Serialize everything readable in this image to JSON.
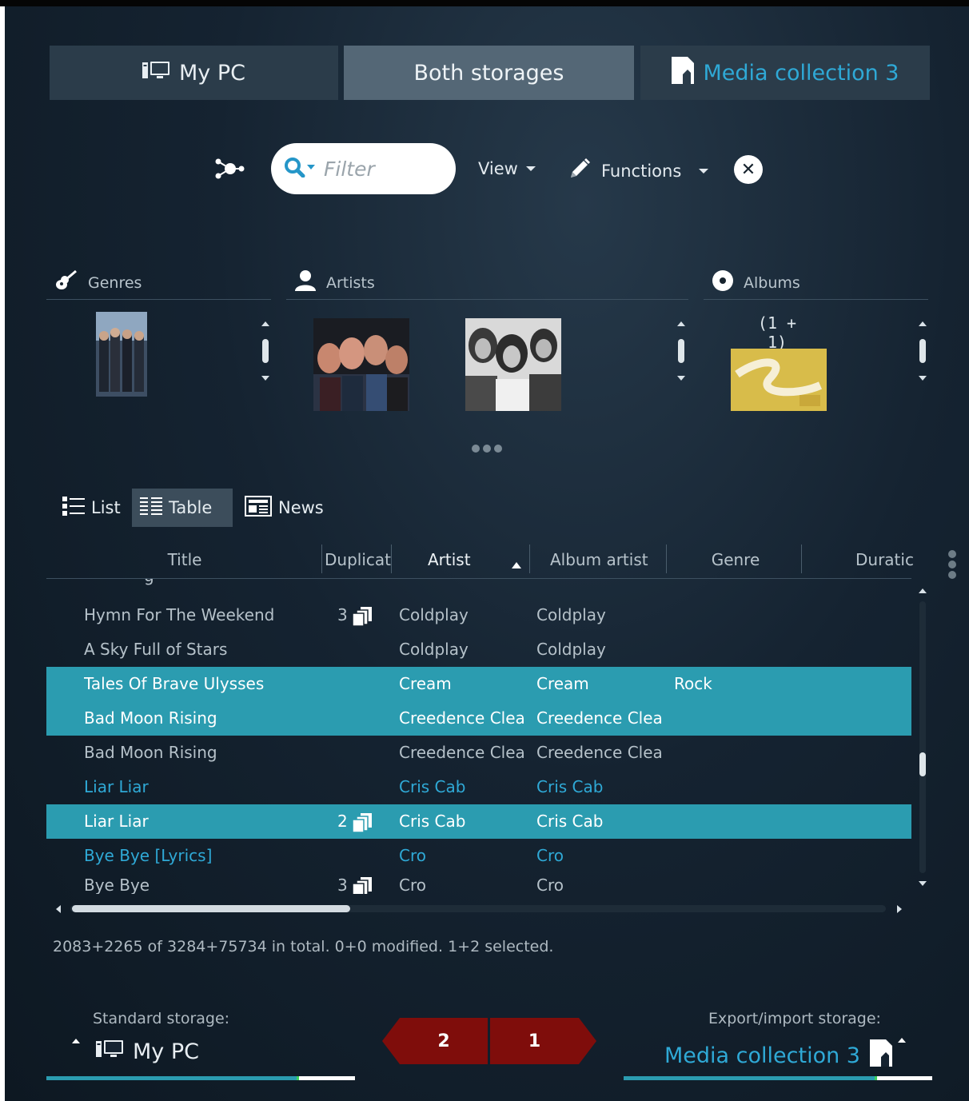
{
  "storage_tabs": {
    "my_pc": "My PC",
    "both": "Both storages",
    "media": "Media collection 3"
  },
  "toolbar": {
    "filter_placeholder": "Filter",
    "view": "View",
    "functions": "Functions"
  },
  "browser": {
    "genres": "Genres",
    "artists": "Artists",
    "albums": "Albums",
    "albums_count": "(1 + 1)"
  },
  "view_tabs": {
    "list": "List",
    "table": "Table",
    "news": "News"
  },
  "table": {
    "columns": [
      "Title",
      "Duplicat",
      "Artist",
      "Album artist",
      "Genre",
      "Duratic"
    ],
    "rows": [
      {
        "title": "Hymn For The Weekend",
        "dup": "3",
        "artist": "Coldplay",
        "album_artist": "Coldplay",
        "genre": ""
      },
      {
        "title": "A Sky Full of Stars",
        "dup": "",
        "artist": "Coldplay",
        "album_artist": "Coldplay",
        "genre": ""
      },
      {
        "title": "Tales Of Brave Ulysses",
        "dup": "",
        "artist": "Cream",
        "album_artist": "Cream",
        "genre": "Rock"
      },
      {
        "title": "Bad Moon Rising",
        "dup": "",
        "artist": "Creedence Clea",
        "album_artist": "Creedence Clea",
        "genre": ""
      },
      {
        "title": "Bad Moon Rising",
        "dup": "",
        "artist": "Creedence Clea",
        "album_artist": "Creedence Clea",
        "genre": ""
      },
      {
        "title": "Liar Liar",
        "dup": "",
        "artist": "Cris Cab",
        "album_artist": "Cris Cab",
        "genre": ""
      },
      {
        "title": "Liar Liar",
        "dup": "2",
        "artist": "Cris Cab",
        "album_artist": "Cris Cab",
        "genre": ""
      },
      {
        "title": "Bye Bye [Lyrics]",
        "dup": "",
        "artist": "Cro",
        "album_artist": "Cro",
        "genre": ""
      },
      {
        "title": "Bye Bye",
        "dup": "3",
        "artist": "Cro",
        "album_artist": "Cro",
        "genre": ""
      }
    ]
  },
  "status": "2083+2265 of 3284+75734 in total. 0+0 modified. 1+2 selected.",
  "bottom": {
    "standard_label": "Standard storage:",
    "standard_value": "My PC",
    "export_label": "Export/import storage:",
    "export_value": "Media collection 3",
    "sync_left": "2",
    "sync_right": "1"
  },
  "colors": {
    "accent": "#2b9cb0",
    "link": "#2fa9d6",
    "sync": "#7f0d0b"
  },
  "icons": [
    "pc-icon",
    "media-device-icon",
    "network-icon",
    "search-icon",
    "pencil-icon",
    "close-icon",
    "guitar-icon",
    "person-icon",
    "disc-icon",
    "list-icon",
    "table-icon",
    "news-icon",
    "duplicate-icon"
  ]
}
